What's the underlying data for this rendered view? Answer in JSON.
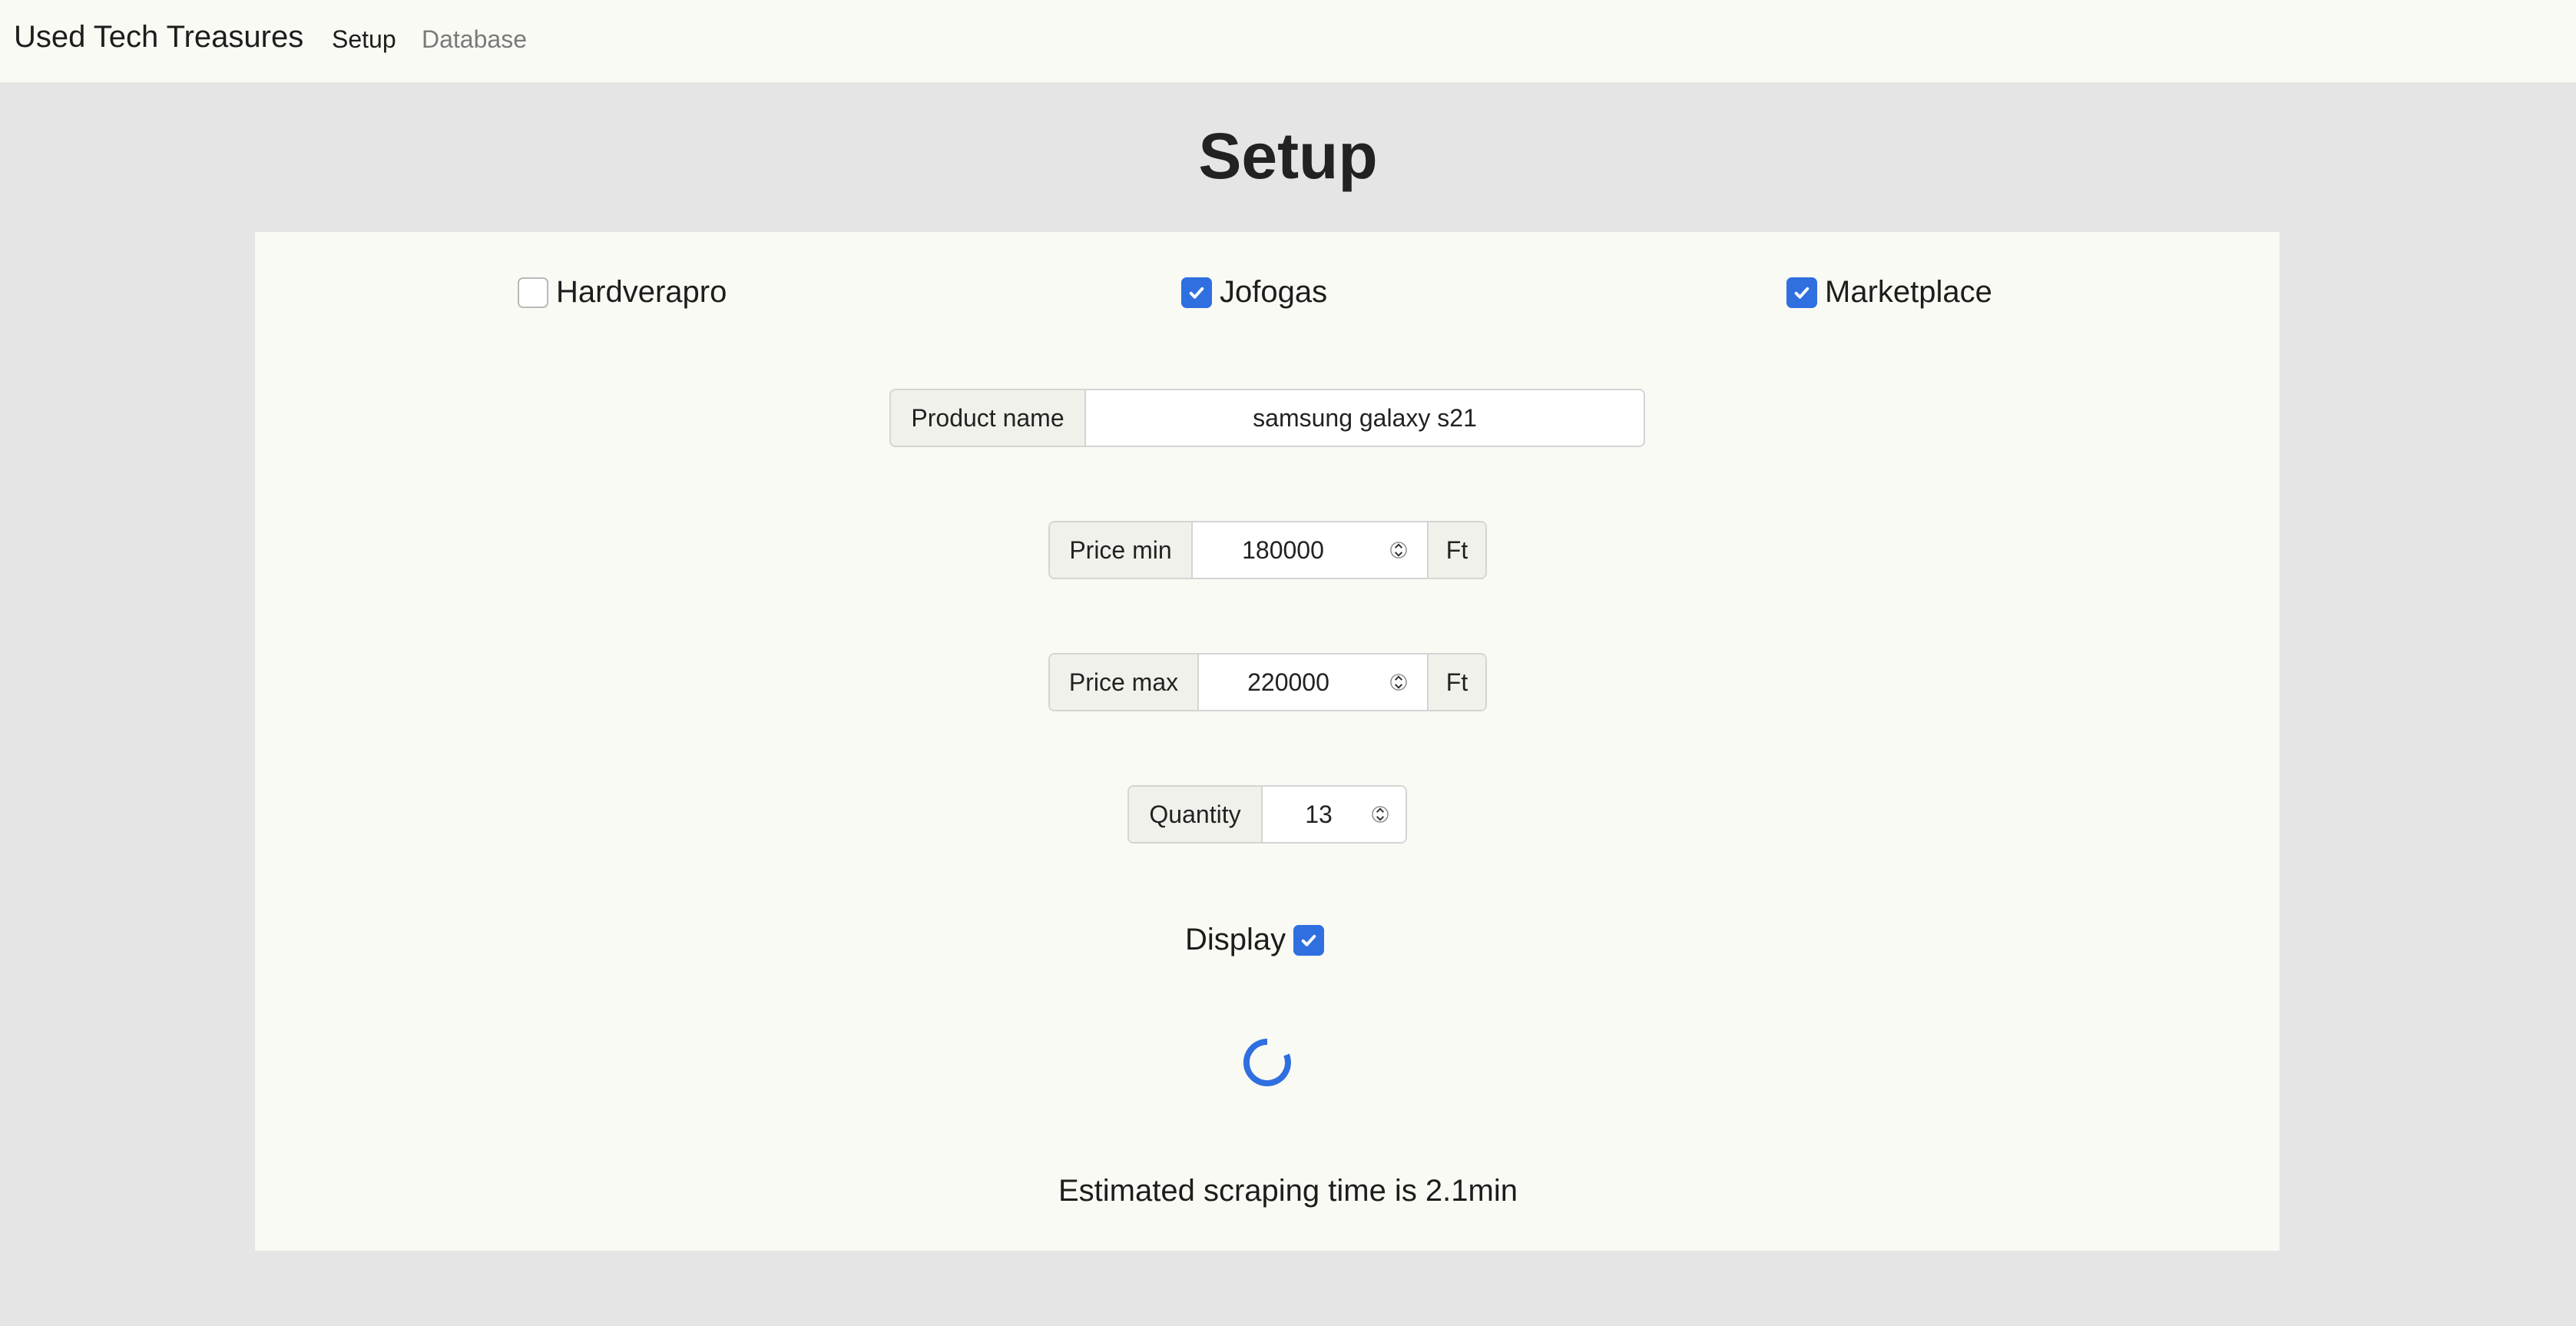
{
  "nav": {
    "brand": "Used Tech Treasures",
    "links": [
      {
        "label": "Setup",
        "active": true
      },
      {
        "label": "Database",
        "active": false
      }
    ]
  },
  "page": {
    "title": "Setup"
  },
  "sources": [
    {
      "label": "Hardverapro",
      "checked": false
    },
    {
      "label": "Jofogas",
      "checked": true
    },
    {
      "label": "Marketplace",
      "checked": true
    }
  ],
  "form": {
    "product_name": {
      "label": "Product name",
      "value": "samsung galaxy s21"
    },
    "price_min": {
      "label": "Price min",
      "value": "180000",
      "unit": "Ft"
    },
    "price_max": {
      "label": "Price max",
      "value": "220000",
      "unit": "Ft"
    },
    "quantity": {
      "label": "Quantity",
      "value": "13"
    },
    "display": {
      "label": "Display",
      "checked": true
    }
  },
  "status": {
    "estimate_text": "Estimated scraping time is 2.1min"
  },
  "colors": {
    "accent": "#2f6fe0",
    "navbar_bg": "#fafaf4",
    "page_bg": "#e5e5e5",
    "card_bg": "#fafaf4"
  },
  "icons": {
    "check": "checkmark-icon",
    "loader": "loading-spinner-icon",
    "stepper": "stepper-arrows-icon"
  }
}
